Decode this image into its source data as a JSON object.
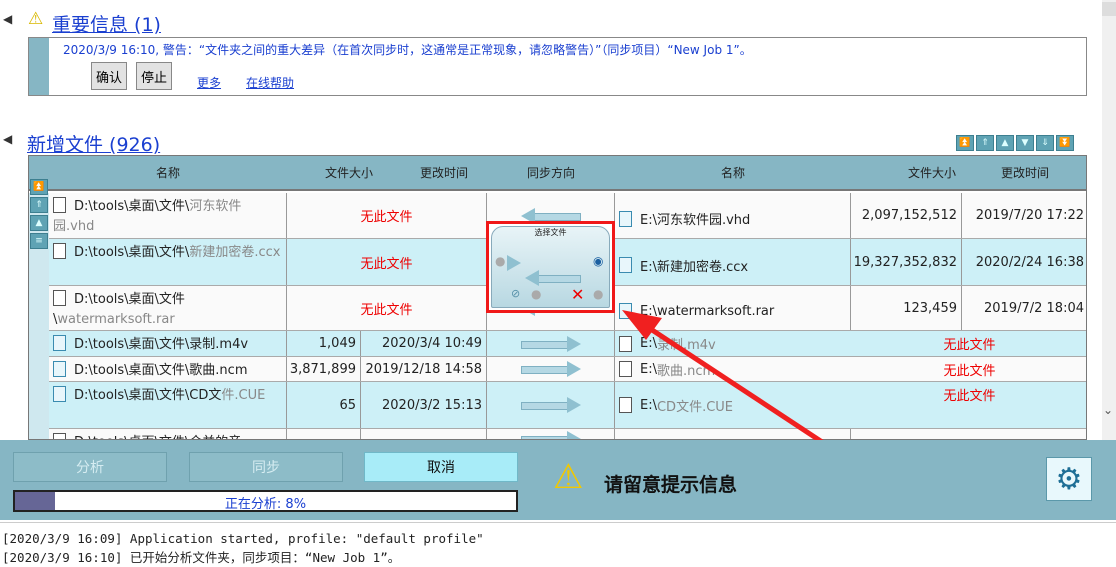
{
  "important": {
    "title": "重要信息 (1)",
    "message": "2020/3/9 16:10, 警告：“文件夹之间的重大差异（在首次同步时，这通常是正常现象，请忽略警告）”（同步项目）“New Job 1”。",
    "confirm": "确认",
    "stop": "停止",
    "more": "更多",
    "help": "在线帮助"
  },
  "newfiles": {
    "title": "新增文件 (926)",
    "headers": {
      "name": "名称",
      "size": "文件大小",
      "time": "更改时间",
      "dir": "同步方向"
    },
    "rows": [
      {
        "l_path": "D:\\tools\\桌面\\文件\\",
        "l_gray": "河东软件园.vhd",
        "l_status": "无此文件",
        "r_name": "E:\\河东软件园.vhd",
        "r_size": "2,097,152,512",
        "r_time": "2019/7/20 17:22"
      },
      {
        "l_path": "D:\\tools\\桌面\\文件\\",
        "l_gray": "新建加密卷.ccx",
        "l_status": "无此文件",
        "r_name": "E:\\新建加密卷.ccx",
        "r_size": "19,327,352,832",
        "r_time": "2020/2/24 16:38"
      },
      {
        "l_path": "D:\\tools\\桌面\\文件\\",
        "l_gray": "watermarksoft.rar",
        "l_status": "无此文件",
        "r_name": "E:\\watermarksoft.rar",
        "r_size": "123,459",
        "r_time": "2019/7/2 18:04"
      },
      {
        "l_path": "D:\\tools\\桌面\\文件\\录制.m4v",
        "l_size": "1,049",
        "l_time": "2020/3/4 10:49",
        "r_pre": "E:\\",
        "r_gray": "录制.m4v",
        "r_status": "无此文件"
      },
      {
        "l_path": "D:\\tools\\桌面\\文件\\歌曲.ncm",
        "l_size": "3,871,899",
        "l_time": "2019/12/18 14:58",
        "r_pre": "E:\\",
        "r_gray": "歌曲.ncm",
        "r_status": "无此文件"
      },
      {
        "l_path": "D:\\tools\\桌面\\文件\\CD文",
        "l_gray": "件.CUE",
        "l_size": "65",
        "l_time": "2020/3/2 15:13",
        "r_pre": "E:\\",
        "r_gray": "CD文件.CUE",
        "r_status": "无此文件"
      },
      {
        "l_path": "D:\\tools\\桌面\\文件\\合并的音"
      }
    ]
  },
  "popup": {
    "title": "选择文件"
  },
  "bottom": {
    "analyze": "分析",
    "sync": "同步",
    "cancel": "取消",
    "progress_label": "正在分析: 8%",
    "progress": 0.08,
    "notice": "请留意提示信息"
  },
  "log": [
    "[2020/3/9 16:09] Application started, profile: \"default profile\"",
    "[2020/3/9 16:10] 已开始分析文件夹，同步项目：“New Job 1”。"
  ]
}
